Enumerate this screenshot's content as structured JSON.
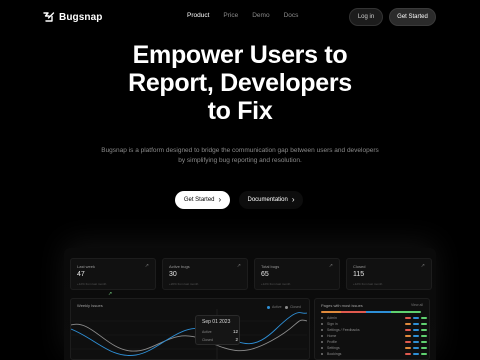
{
  "nav": {
    "brand": "Bugsnap",
    "links": [
      "Product",
      "Price",
      "Demo",
      "Docs"
    ],
    "active": "Product",
    "login_label": "Log in",
    "get_started_label": "Get Started"
  },
  "hero": {
    "title_line1": "Empower Users to",
    "title_line2": "Report, Developers",
    "title_line3": "to Fix",
    "subtitle": "Bugsnap is a platform designed to bridge the communication gap between users and developers by simplifying bug reporting and resolution.",
    "cta_primary": "Get Started",
    "cta_secondary": "Documentation"
  },
  "dashboard": {
    "stats": [
      {
        "label": "Last week",
        "value": "47",
        "note": "+12% from last month"
      },
      {
        "label": "Active bugs",
        "value": "30",
        "note": "+20% from last month"
      },
      {
        "label": "Total bugs",
        "value": "65",
        "note": "+12% from last month"
      },
      {
        "label": "Closed",
        "value": "115",
        "note": "+12% from last month"
      }
    ],
    "chart": {
      "title": "Weekly Issues",
      "legend": [
        "Active",
        "Closed"
      ],
      "tooltip": {
        "date": "Sep 01 2023",
        "rows": [
          {
            "label": "Active",
            "value": "12"
          },
          {
            "label": "Closed",
            "value": "2"
          }
        ]
      }
    },
    "side": {
      "title": "Pages with most issues",
      "view_all": "View all",
      "items": [
        "Admin",
        "Sign in",
        "Settings / Feedbacks",
        "Home",
        "Profile",
        "Settings",
        "Bookings"
      ]
    }
  },
  "colors": {
    "accent_blue": "#2e8fd6",
    "accent_gray": "#8d8d8d",
    "background": "#000000",
    "status_green": "#5fd170",
    "status_red": "#e05a4f",
    "status_orange": "#e08a3c"
  }
}
